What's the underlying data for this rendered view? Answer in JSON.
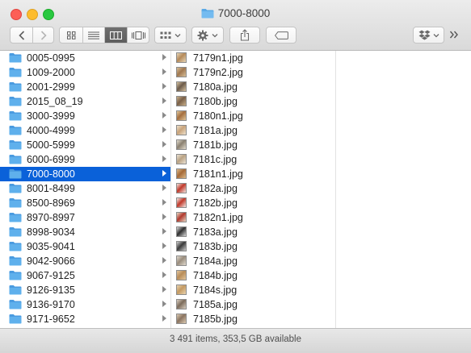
{
  "window": {
    "title": "7000-8000"
  },
  "toolbar": {
    "back": "back",
    "forward": "forward",
    "views": [
      "icon-view",
      "list-view",
      "column-view",
      "cover-flow-view"
    ],
    "active_view": "column-view"
  },
  "column1": {
    "items": [
      {
        "label": "0005-0995"
      },
      {
        "label": "1009-2000"
      },
      {
        "label": "2001-2999"
      },
      {
        "label": "2015_08_19"
      },
      {
        "label": "3000-3999"
      },
      {
        "label": "4000-4999"
      },
      {
        "label": "5000-5999"
      },
      {
        "label": "6000-6999"
      },
      {
        "label": "7000-8000",
        "selected": true
      },
      {
        "label": "8001-8499"
      },
      {
        "label": "8500-8969"
      },
      {
        "label": "8970-8997"
      },
      {
        "label": "8998-9034"
      },
      {
        "label": "9035-9041"
      },
      {
        "label": "9042-9066"
      },
      {
        "label": "9067-9125"
      },
      {
        "label": "9126-9135"
      },
      {
        "label": "9136-9170"
      },
      {
        "label": "9171-9652"
      }
    ]
  },
  "column2": {
    "items": [
      {
        "label": "7179n1.jpg",
        "c1": "#b58a5a",
        "c2": "#e8d7b8"
      },
      {
        "label": "7179n2.jpg",
        "c1": "#a07850",
        "c2": "#d8c09a"
      },
      {
        "label": "7180a.jpg",
        "c1": "#6b5a4a",
        "c2": "#d6c2a0"
      },
      {
        "label": "7180b.jpg",
        "c1": "#7a6048",
        "c2": "#c9b08a"
      },
      {
        "label": "7180n1.jpg",
        "c1": "#a46e3e",
        "c2": "#e2c79a"
      },
      {
        "label": "7181a.jpg",
        "c1": "#c8a37a",
        "c2": "#efe3cf"
      },
      {
        "label": "7181b.jpg",
        "c1": "#8a8070",
        "c2": "#e3ddd0"
      },
      {
        "label": "7181c.jpg",
        "c1": "#b9a283",
        "c2": "#ece4d6"
      },
      {
        "label": "7181n1.jpg",
        "c1": "#a66a38",
        "c2": "#dcbb8c"
      },
      {
        "label": "7182a.jpg",
        "c1": "#c0392b",
        "c2": "#f2e6e1"
      },
      {
        "label": "7182b.jpg",
        "c1": "#c0392b",
        "c2": "#f4ece8"
      },
      {
        "label": "7182n1.jpg",
        "c1": "#b03a2e",
        "c2": "#e7d7c4"
      },
      {
        "label": "7183a.jpg",
        "c1": "#2e2e2e",
        "c2": "#dcdcdc"
      },
      {
        "label": "7183b.jpg",
        "c1": "#3a3a3a",
        "c2": "#cfcfcf"
      },
      {
        "label": "7184a.jpg",
        "c1": "#9a8d7d",
        "c2": "#e2dbd0"
      },
      {
        "label": "7184b.jpg",
        "c1": "#b88c58",
        "c2": "#e3c79e"
      },
      {
        "label": "7184s.jpg",
        "c1": "#c49a62",
        "c2": "#ead4b0"
      },
      {
        "label": "7185a.jpg",
        "c1": "#7c6b5a",
        "c2": "#d9cfc2"
      },
      {
        "label": "7185b.jpg",
        "c1": "#8a7460",
        "c2": "#dccab2"
      }
    ]
  },
  "statusbar": {
    "text": "3 491 items, 353,5 GB available"
  },
  "colors": {
    "selection": "#0a61d9",
    "folder": "#5aa9e6"
  }
}
